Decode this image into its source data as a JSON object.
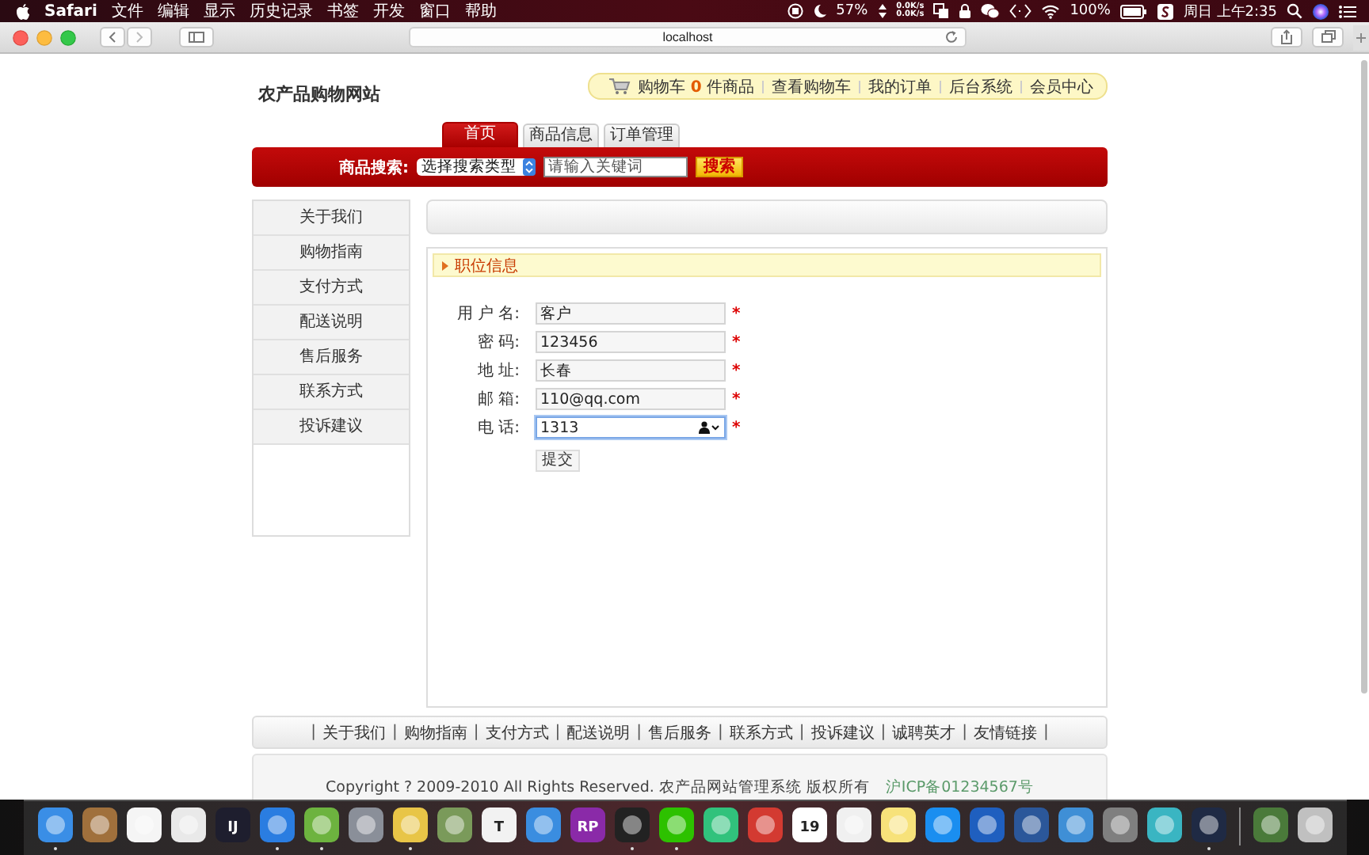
{
  "menubar": {
    "app": "Safari",
    "menus": [
      "文件",
      "编辑",
      "显示",
      "历史记录",
      "书签",
      "开发",
      "窗口",
      "帮助"
    ],
    "battery_level": "57%",
    "net_up": "0.0K/s",
    "net_down": "0.0K/s",
    "power": "100%",
    "clock": "周日 上午2:35"
  },
  "browser": {
    "address": "localhost"
  },
  "site": {
    "title": "农产品购物网站",
    "cart": {
      "prefix": "购物车",
      "count": "0",
      "suffix": "件商品"
    },
    "top_links": [
      "查看购物车",
      "我的订单",
      "后台系统",
      "会员中心"
    ],
    "tabs": [
      {
        "label": "首页",
        "selected": true
      },
      {
        "label": "商品信息",
        "selected": false
      },
      {
        "label": "订单管理",
        "selected": false
      }
    ],
    "search": {
      "label": "商品搜索:",
      "type_select": "选择搜索类型",
      "placeholder": "请输入关键词",
      "button": "搜索"
    },
    "sidebar": {
      "items": [
        "关于我们",
        "购物指南",
        "支付方式",
        "配送说明",
        "售后服务",
        "联系方式",
        "投诉建议"
      ]
    },
    "panel": {
      "title": "职位信息",
      "fields": [
        {
          "label": "用 户 名:",
          "value": "客户",
          "mark": "*",
          "focused": false
        },
        {
          "label": "密 码:",
          "value": "123456",
          "mark": "*",
          "focused": false
        },
        {
          "label": "地 址:",
          "value": "长春",
          "mark": "*",
          "focused": false
        },
        {
          "label": "邮 箱:",
          "value": "110@qq.com",
          "mark": "*",
          "focused": false
        },
        {
          "label": "电 话:",
          "value": "1313",
          "mark": "*",
          "focused": true
        }
      ],
      "submit": "提交"
    },
    "footer": {
      "separator": "|",
      "links": [
        "关于我们",
        "购物指南",
        "支付方式",
        "配送说明",
        "售后服务",
        "联系方式",
        "投诉建议",
        "诚聘英才",
        "友情链接"
      ],
      "copyright": "Copyright ? 2009-2010 All Rights Reserved. 农产品网站管理系统 版权所有",
      "icp": "沪ICP备01234567号"
    }
  },
  "dock": {
    "apps": [
      {
        "color": "#3a8ee6",
        "running": true
      },
      {
        "color": "#a0703c",
        "running": false
      },
      {
        "color": "#f5f5f5",
        "running": false
      },
      {
        "color": "#e9e9e9",
        "running": false
      },
      {
        "color": "#1e1e2e",
        "running": false,
        "label": "IJ"
      },
      {
        "color": "#2a7de1",
        "running": true
      },
      {
        "color": "#6db33f",
        "running": true
      },
      {
        "color": "#8a8f99",
        "running": false
      },
      {
        "color": "#e8c547",
        "running": true
      },
      {
        "color": "#7a9a5a",
        "running": false
      },
      {
        "color": "#f2f2f2",
        "running": false,
        "label": "T"
      },
      {
        "color": "#3a8de0",
        "running": false
      },
      {
        "color": "#8a2aa8",
        "running": false,
        "label": "RP"
      },
      {
        "color": "#222222",
        "running": true
      },
      {
        "color": "#2dc100",
        "running": true
      },
      {
        "color": "#31c27c",
        "running": false
      },
      {
        "color": "#d33a31",
        "running": false
      },
      {
        "color": "#ffffff",
        "running": false,
        "label": "19"
      },
      {
        "color": "#f0f0f0",
        "running": false
      },
      {
        "color": "#f7e27a",
        "running": false
      },
      {
        "color": "#1a8ef0",
        "running": false
      },
      {
        "color": "#1f5fbf",
        "running": false
      },
      {
        "color": "#2b579a",
        "running": false
      },
      {
        "color": "#3f8fd6",
        "running": false
      },
      {
        "color": "#7f7f7f",
        "running": false
      },
      {
        "color": "#3ab5c2",
        "running": false
      },
      {
        "color": "#1f2a44",
        "running": true
      }
    ],
    "pinned": [
      {
        "color": "#4a7a3a",
        "running": false
      },
      {
        "color": "#c0c0c0",
        "running": false
      }
    ]
  }
}
